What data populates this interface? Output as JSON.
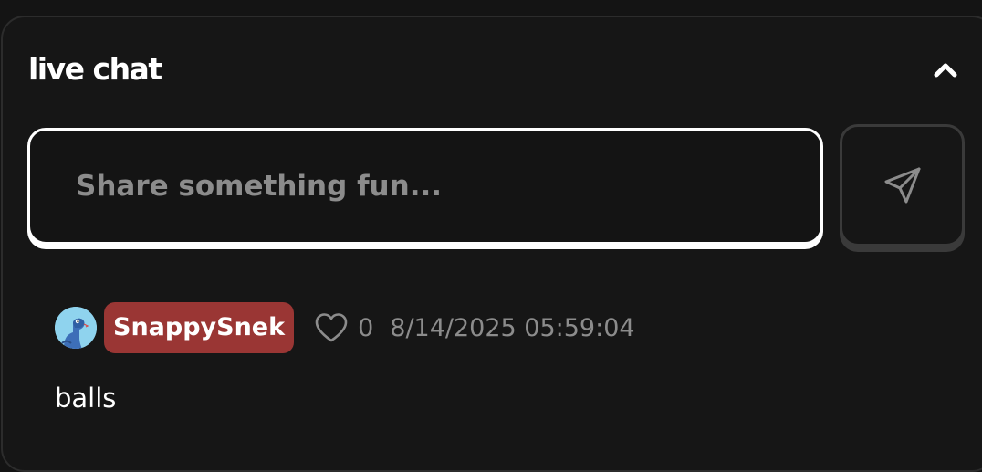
{
  "chat": {
    "title": "live chat",
    "input_placeholder": "Share something fun..."
  },
  "icons": {
    "collapse": "chevron-up-icon",
    "send": "send-icon",
    "like": "heart-icon"
  },
  "messages": [
    {
      "username": "SnappySnek",
      "likes": "0",
      "timestamp": "8/14/2025 05:59:04",
      "text": "balls",
      "badge_color": "#9a3634"
    }
  ],
  "colors": {
    "background": "#161616",
    "muted_text": "#8c8c8c",
    "badge": "#9a3634"
  }
}
